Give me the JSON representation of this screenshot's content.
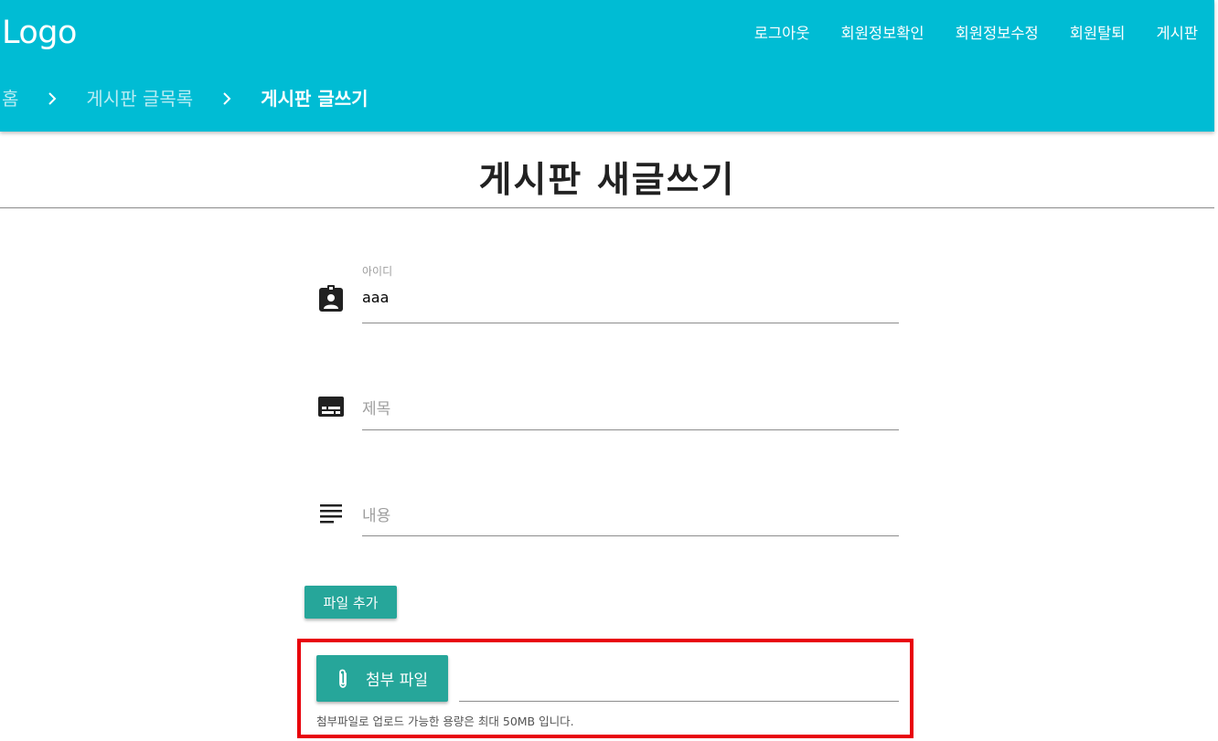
{
  "header": {
    "logo": "Logo",
    "nav": [
      "로그아웃",
      "회원정보확인",
      "회원정보수정",
      "회원탈퇴",
      "게시판"
    ],
    "breadcrumb": [
      "홈",
      "게시판 글목록",
      "게시판 글쓰기"
    ],
    "background_color": "#00bcd4"
  },
  "main": {
    "title": "게시판 새글쓰기",
    "fields": {
      "id": {
        "label": "아이디",
        "value": "aaa",
        "icon": "badge-icon"
      },
      "title": {
        "placeholder": "제목",
        "icon": "subtitles-icon"
      },
      "content": {
        "placeholder": "내용",
        "icon": "notes-icon"
      }
    },
    "add_file_button": "파일 추가",
    "attachment": {
      "button_label": "첨부 파일",
      "icon": "paperclip-icon",
      "helper_text": "첨부파일로 업로드 가능한 용량은 최대 50MB 입니다.",
      "button_color": "#26a69a"
    },
    "highlight_color": "#e8000b"
  }
}
